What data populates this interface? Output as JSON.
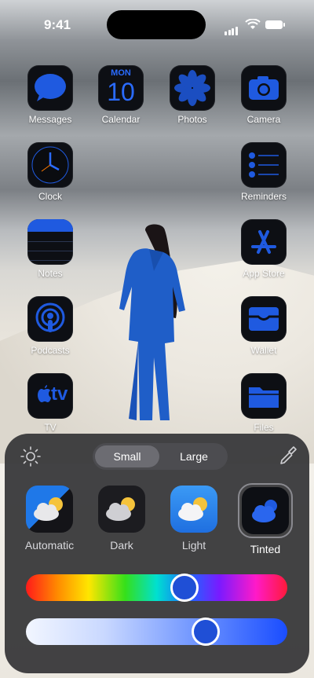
{
  "status": {
    "time": "9:41"
  },
  "apps": [
    {
      "name": "Messages"
    },
    {
      "name": "Calendar",
      "cal_day": "MON",
      "cal_date": "10"
    },
    {
      "name": "Photos"
    },
    {
      "name": "Camera"
    },
    {
      "name": "Clock"
    },
    {
      "name": "Reminders"
    },
    {
      "name": "Notes"
    },
    {
      "name": "App Store"
    },
    {
      "name": "Podcasts"
    },
    {
      "name": "Wallet"
    },
    {
      "name": "TV",
      "tv_text": "tv"
    },
    {
      "name": "Files"
    }
  ],
  "panel": {
    "size_options": [
      "Small",
      "Large"
    ],
    "selected_size": "Small",
    "styles": [
      "Automatic",
      "Dark",
      "Light",
      "Tinted"
    ],
    "selected_style": "Tinted",
    "hue_level": 0.62,
    "saturation_level": 0.71,
    "tint_color": "#1f4fd6"
  },
  "colors": {
    "icon_blue": "#1f5ae0",
    "icon_bg": "#0d0f14"
  }
}
